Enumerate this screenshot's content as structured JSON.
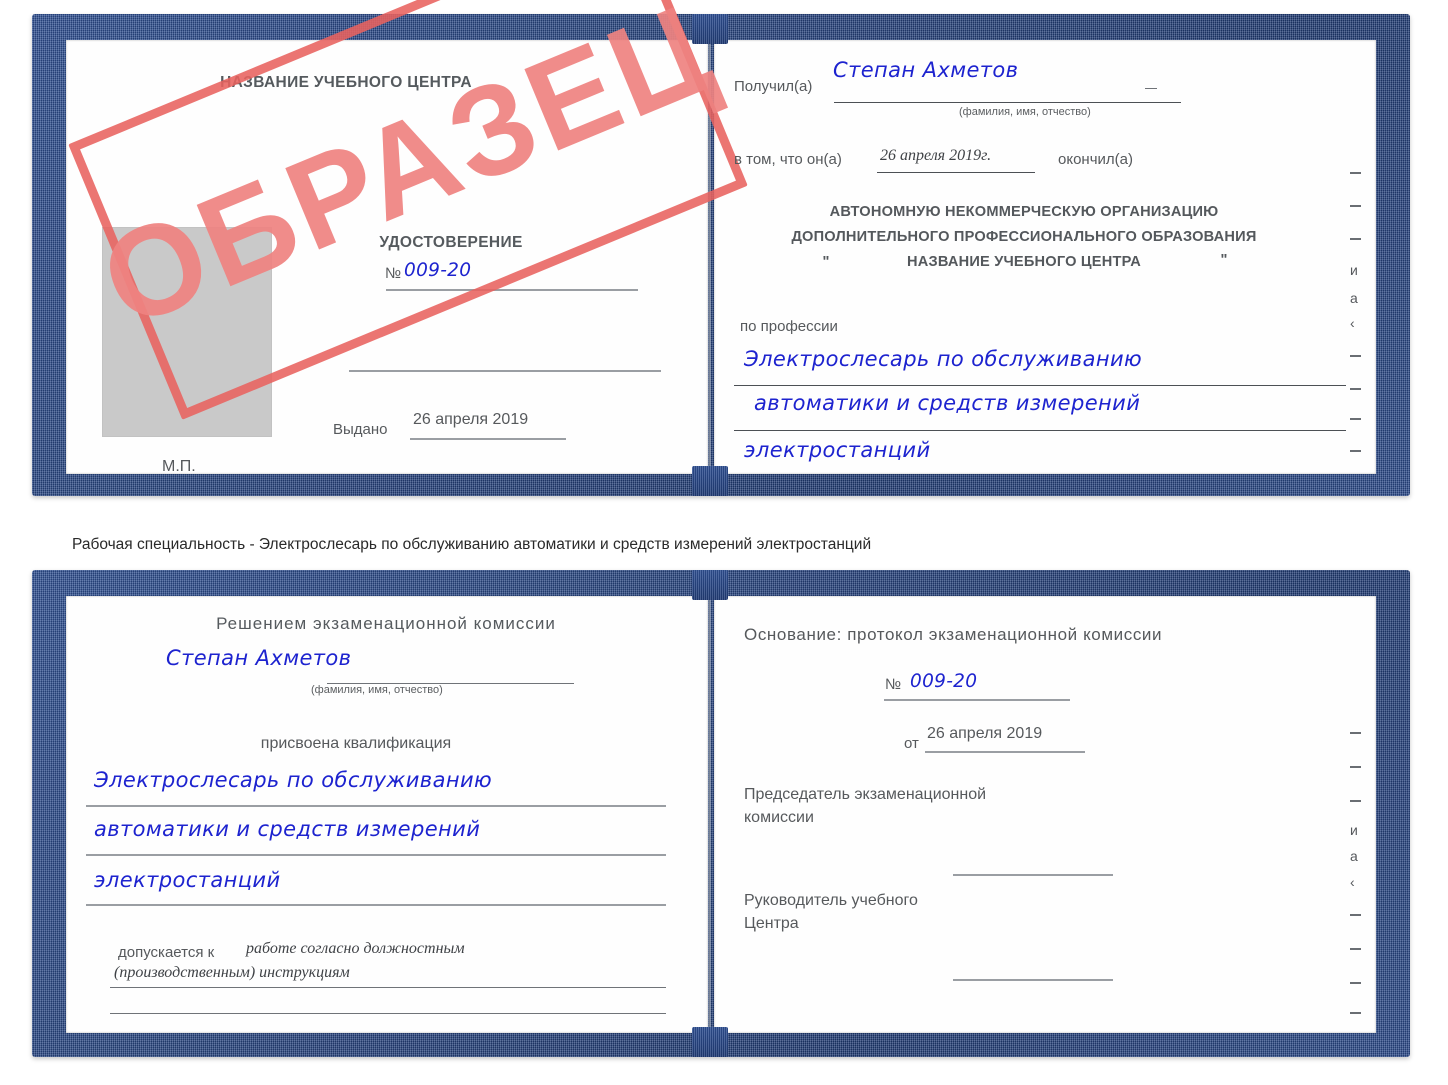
{
  "document": {
    "type": "Удостоверение",
    "caption": "Рабочая специальность - Электрослесарь по обслуживанию автоматики и средств измерений электростанций",
    "watermark": "ОБРАЗЕЦ",
    "colors": {
      "cover_blue": "#27447f",
      "stamp_red": "#e8625f",
      "stamp_text_red": "#ef8381",
      "handwriting_blue": "#1d23cf",
      "photo_placeholder_gray": "#c9c9c9"
    }
  },
  "certificate_top": {
    "left_page": {
      "center_name": "НАЗВАНИЕ УЧЕБНОГО ЦЕНТРА",
      "title": "УДОСТОВЕРЕНИЕ",
      "number_label": "№",
      "number_value": "009-20",
      "issued_label": "Выдано",
      "issued_value": "26 апреля 2019",
      "seal_label": "М.П."
    },
    "right_page": {
      "received_label": "Получил(а)",
      "received_name": "Степан Ахметов",
      "fio_hint": "(фамилия, имя, отчество)",
      "that_he_label": "в том, что он(а)",
      "finish_date": "26 апреля 2019г.",
      "finished_label": "окончил(а)",
      "org_line1": "АВТОНОМНУЮ НЕКОММЕРЧЕСКУЮ ОРГАНИЗАЦИЮ",
      "org_line2": "ДОПОЛНИТЕЛЬНОГО ПРОФЕССИОНАЛЬНОГО ОБРАЗОВАНИЯ",
      "org_quote_open": "\"",
      "org_line3": "НАЗВАНИЕ УЧЕБНОГО ЦЕНТРА",
      "org_quote_close": "\"",
      "profession_label": "по профессии",
      "profession_line1": "Электрослесарь по обслуживанию",
      "profession_line2": "автоматики и средств измерений",
      "profession_line3": "электростанций"
    }
  },
  "certificate_bottom": {
    "left_page": {
      "commission_decision": "Решением экзаменационной комиссии",
      "name": "Степан Ахметов",
      "fio_hint": "(фамилия, имя, отчество)",
      "qualification_label": "присвоена квалификация",
      "qualification_line1": "Электрослесарь по обслуживанию",
      "qualification_line2": "автоматики и средств измерений",
      "qualification_line3": "электростанций",
      "admitted_label": "допускается к",
      "admitted_line1": "работе согласно должностным",
      "admitted_line2": "(производственным) инструкциям"
    },
    "right_page": {
      "basis_label": "Основание: протокол экзаменационной комиссии",
      "protocol_number_label": "№",
      "protocol_number_value": "009-20",
      "protocol_date_label": "от",
      "protocol_date_value": "26 апреля 2019",
      "chairman_line1": "Председатель экзаменационной",
      "chairman_line2": "комиссии",
      "head_line1": "Руководитель учебного",
      "head_line2": "Центра"
    }
  },
  "edge_margin": {
    "chars": [
      "и",
      "а",
      "‹"
    ]
  }
}
